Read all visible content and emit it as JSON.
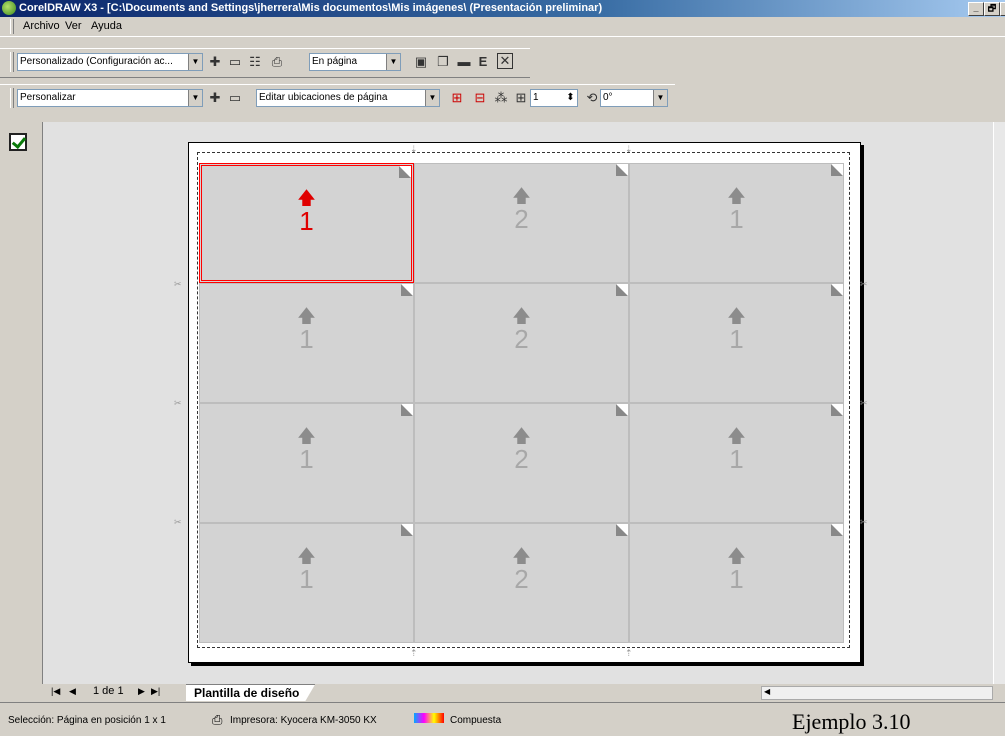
{
  "window": {
    "title": "CorelDRAW X3 - [C:\\Documents and Settings\\jherrera\\Mis documentos\\Mis imágenes\\ (Presentación preliminar)",
    "controls": [
      "_",
      "🗗",
      "x"
    ]
  },
  "menu": {
    "items": [
      {
        "label": "Archivo"
      },
      {
        "label": "Ver"
      },
      {
        "label": "Ayuda"
      }
    ]
  },
  "toolbar1": {
    "preset_value": "Personalizado (Configuración ac...",
    "fit_value": "En página",
    "text_icon": "E"
  },
  "toolbar2": {
    "layout_value": "Personalizar",
    "edit_value": "Editar ubicaciones de página",
    "page_number": "1",
    "rotation": "0°"
  },
  "grid": {
    "rows": [
      [
        "1",
        "2",
        "1"
      ],
      [
        "1",
        "2",
        "1"
      ],
      [
        "1",
        "2",
        "1"
      ],
      [
        "1",
        "2",
        "1"
      ]
    ],
    "selected": [
      0,
      0
    ],
    "arrow_glyph": "🡅",
    "selected_color": "#ff0000"
  },
  "pagenav": {
    "page_count": "1 de 1",
    "tab_label": "Plantilla de diseño"
  },
  "status": {
    "selection": "Selección: Página en posición 1 x 1",
    "printer": "Impresora: Kyocera KM-3050 KX",
    "mode": "Compuesta",
    "caption": "Ejemplo 3.10"
  }
}
